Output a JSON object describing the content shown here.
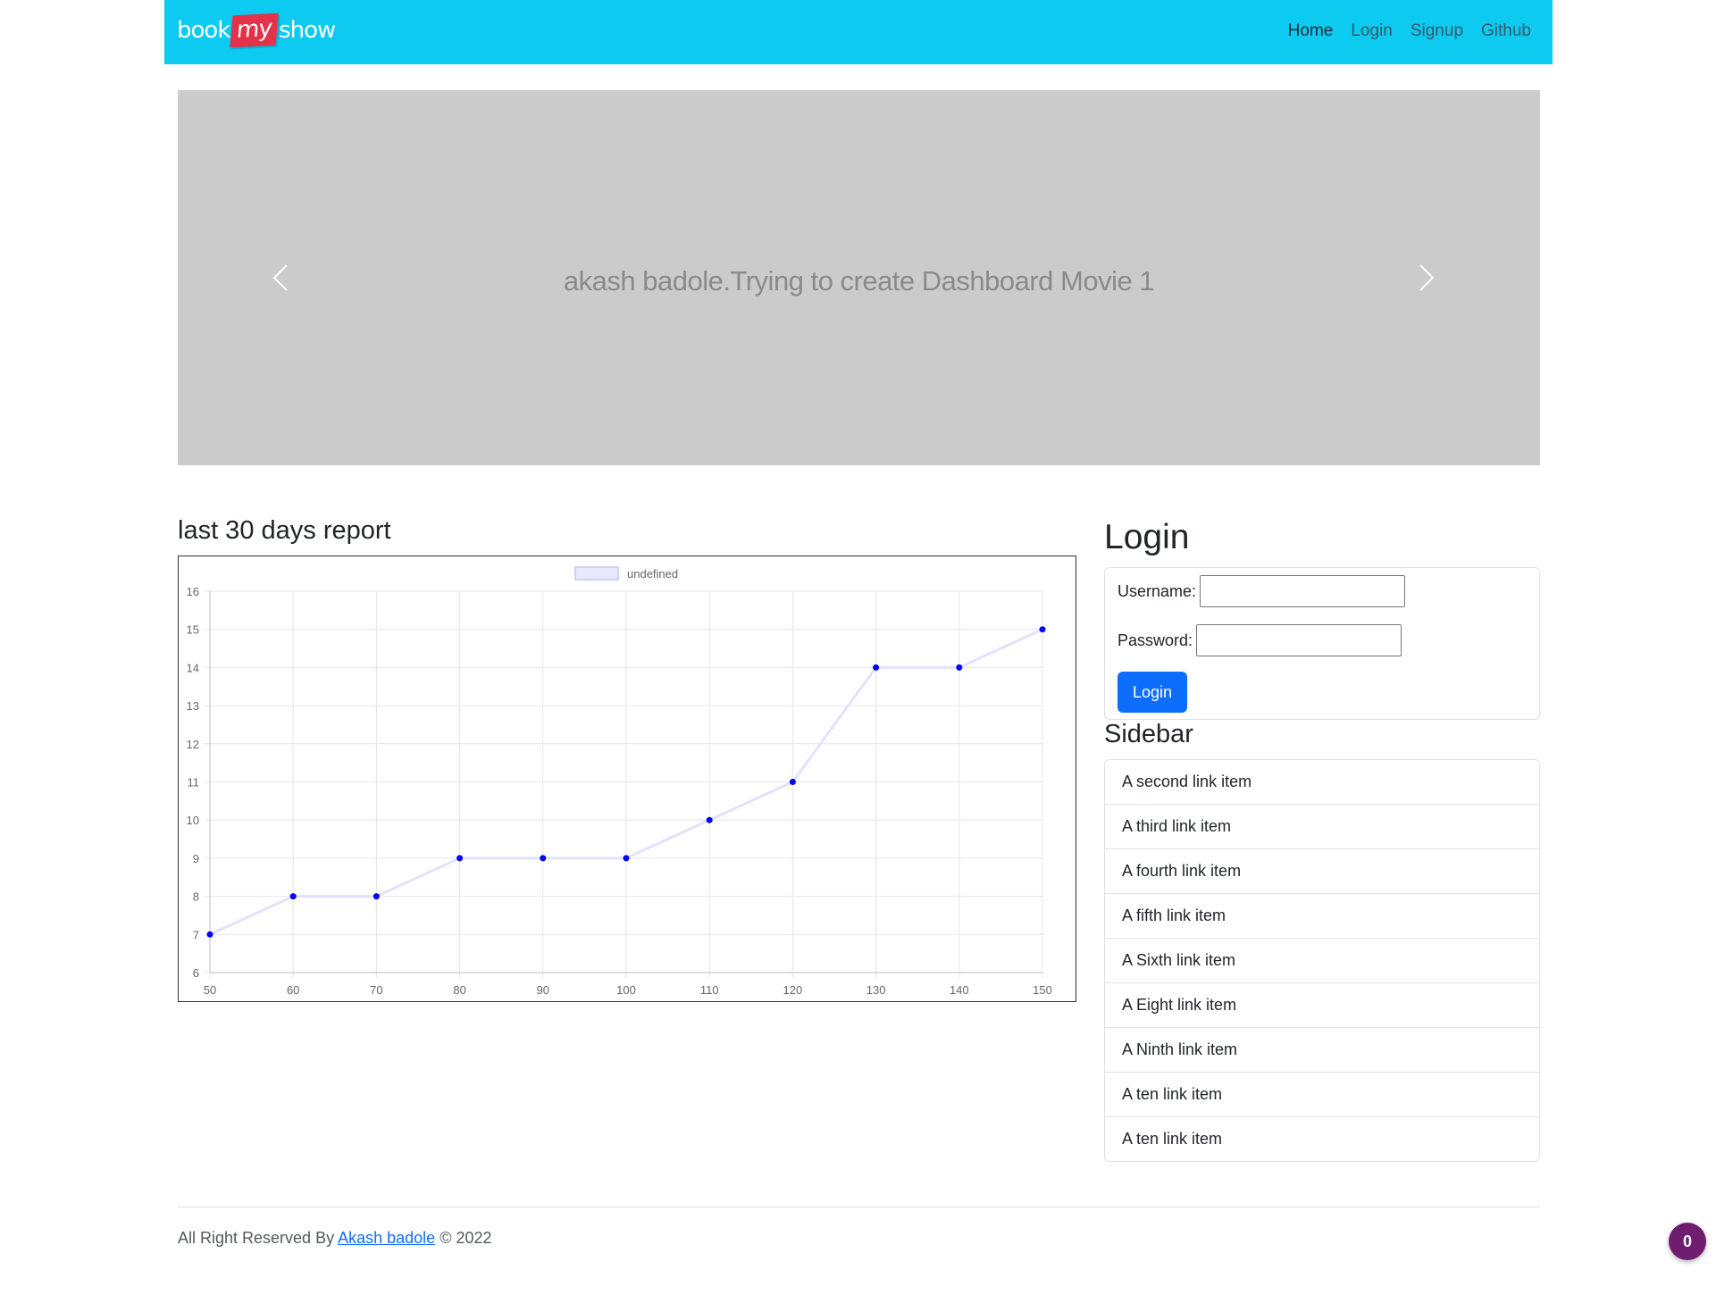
{
  "navbar": {
    "brand_left": "book",
    "brand_mid": "my",
    "brand_right": "show",
    "links": [
      {
        "label": "Home",
        "active": true
      },
      {
        "label": "Login"
      },
      {
        "label": "Signup"
      },
      {
        "label": "Github"
      }
    ]
  },
  "carousel": {
    "caption": "akash badole.Trying to create Dashboard Movie 1"
  },
  "report": {
    "title": "last 30 days report"
  },
  "chart_data": {
    "type": "line",
    "legend": "undefined",
    "legend_position": "top",
    "x": [
      50,
      60,
      70,
      80,
      90,
      100,
      110,
      120,
      130,
      140,
      150
    ],
    "series": [
      {
        "name": "undefined",
        "values": [
          7,
          8,
          8,
          9,
          9,
          9,
          10,
          11,
          14,
          14,
          15
        ]
      }
    ],
    "xlim": [
      50,
      150
    ],
    "ylim": [
      6,
      16
    ],
    "x_ticks": [
      50,
      60,
      70,
      80,
      90,
      100,
      110,
      120,
      130,
      140,
      150
    ],
    "y_ticks": [
      6,
      7,
      8,
      9,
      10,
      11,
      12,
      13,
      14,
      15,
      16
    ],
    "grid": true,
    "line_color": "#e2e2fb",
    "point_color": "#0000ff"
  },
  "login": {
    "title": "Login",
    "username_label": "Username:",
    "username_value": "",
    "password_label": "Password:",
    "password_value": "",
    "button": "Login"
  },
  "sidebar": {
    "title": "Sidebar",
    "items": [
      "A second link item",
      "A third link item",
      "A fourth link item",
      "A fifth link item",
      "A Sixth link item",
      "A Eight link item",
      "A Ninth link item",
      "A ten link item",
      "A ten link item"
    ]
  },
  "footer": {
    "prefix": "All Right Reserved By",
    "author": "Akash badole",
    "suffix": "© 2022"
  },
  "badge": {
    "count": "0"
  },
  "colors": {
    "navbar": "#0dcaf0",
    "primary": "#0d6efd",
    "carousel_bg": "#cbcbcb",
    "badge": "#6f1d6e"
  }
}
